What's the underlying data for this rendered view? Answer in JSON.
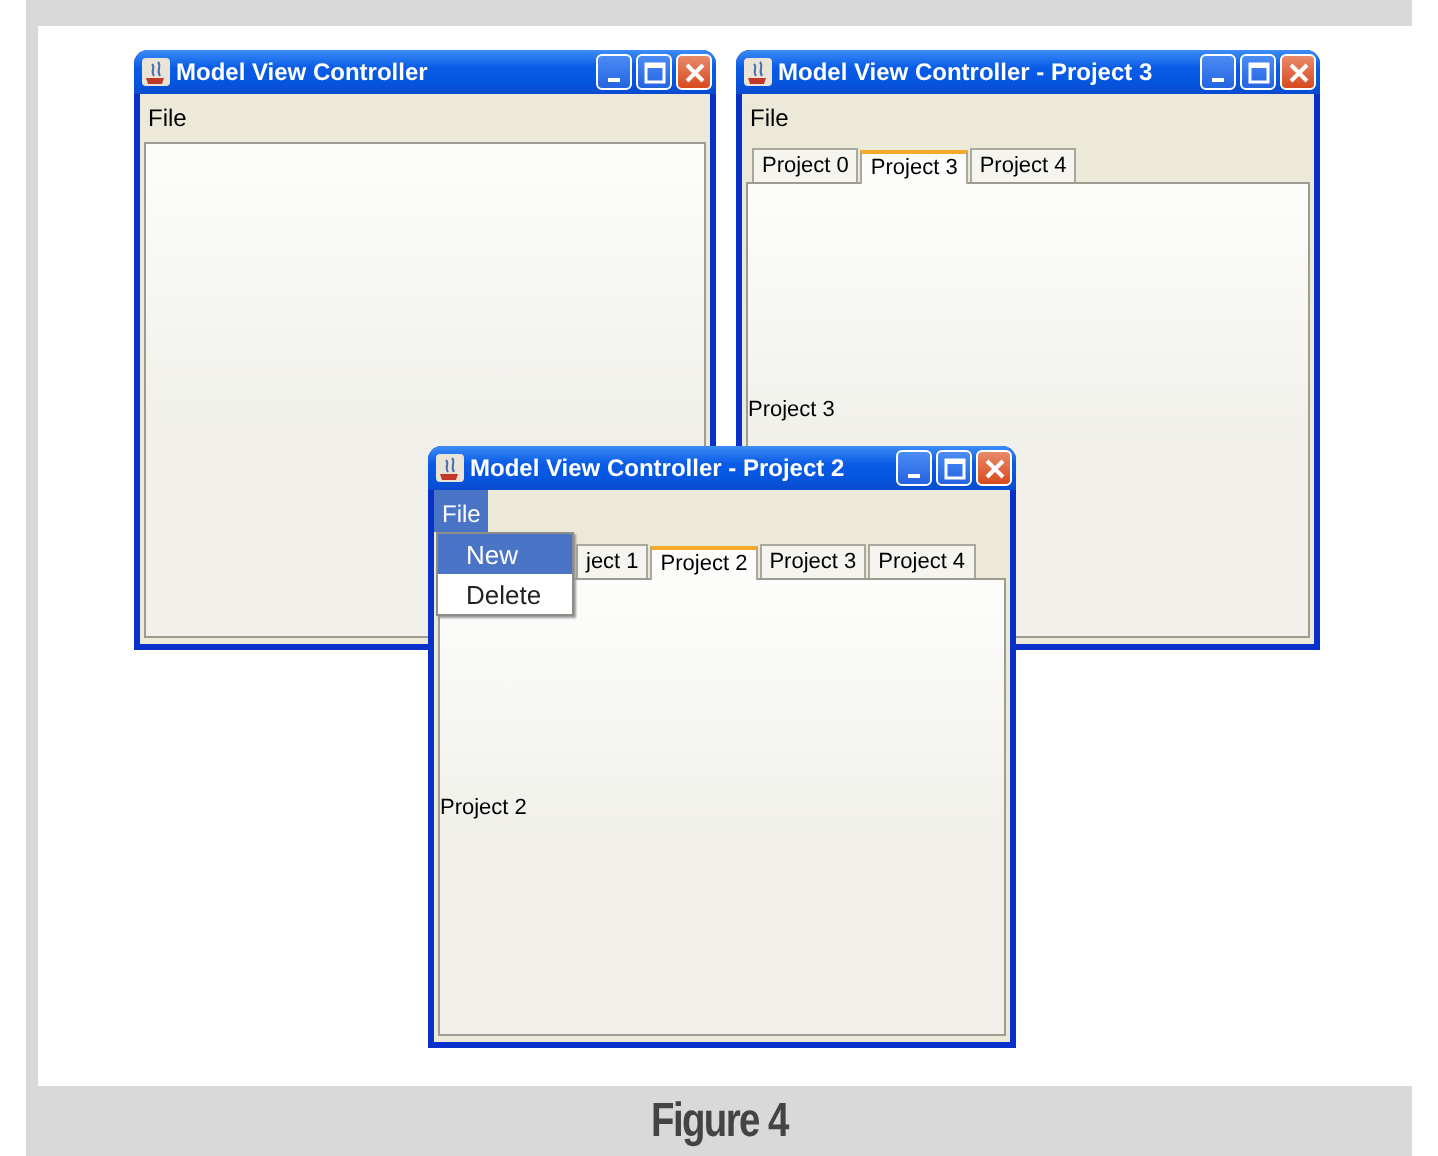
{
  "windows": [
    {
      "title": "Model View Controller",
      "menu": [
        {
          "label": "File",
          "selected": false
        }
      ]
    },
    {
      "title": "Model View Controller - Project 3",
      "menu": [
        {
          "label": "File",
          "selected": false
        }
      ],
      "tabs": [
        {
          "label": "Project 0",
          "selected": false
        },
        {
          "label": "Project 3",
          "selected": true
        },
        {
          "label": "Project 4",
          "selected": false
        }
      ],
      "content_label": "Project 3"
    },
    {
      "title": "Model View Controller - Project 2",
      "menu": [
        {
          "label": "File",
          "selected": true
        }
      ],
      "tabs": [
        {
          "label": "ject 1",
          "selected": false
        },
        {
          "label": "Project 2",
          "selected": true
        },
        {
          "label": "Project 3",
          "selected": false
        },
        {
          "label": "Project 4",
          "selected": false
        }
      ],
      "content_label": "Project 2",
      "open_menu": [
        {
          "label": "New",
          "selected": true
        },
        {
          "label": "Delete",
          "selected": false
        }
      ]
    }
  ],
  "caption": "Figure 4"
}
